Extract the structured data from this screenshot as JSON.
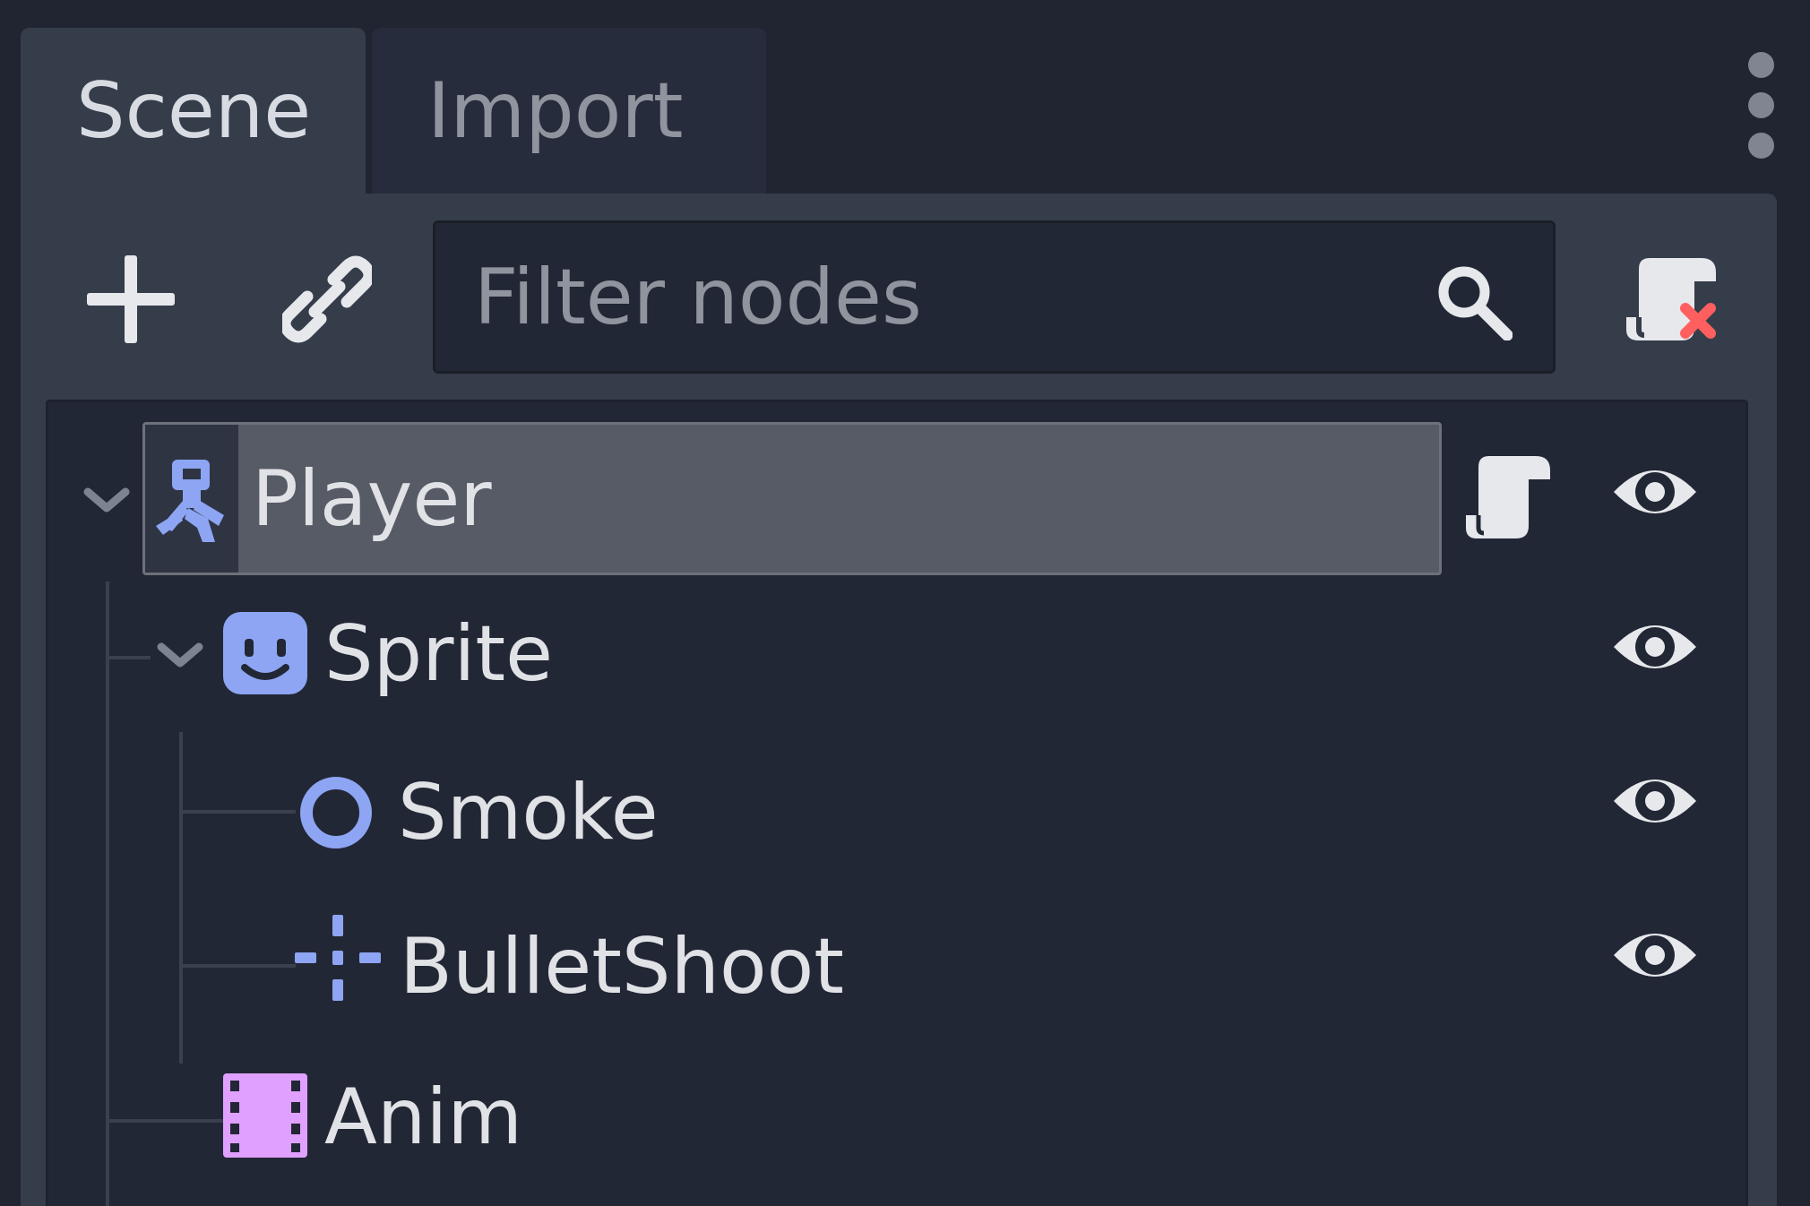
{
  "tabs": [
    {
      "label": "Scene",
      "active": true
    },
    {
      "label": "Import",
      "active": false
    }
  ],
  "toolbar": {
    "add_icon": "plus-icon",
    "link_icon": "link-icon",
    "filter_placeholder": "Filter nodes",
    "filter_value": "",
    "search_icon": "search-icon",
    "script_icon": "script-remove-icon"
  },
  "tree": {
    "nodes": [
      {
        "label": "Player",
        "depth": 0,
        "icon": "kinematic-body-icon",
        "expanded": true,
        "selected": true,
        "has_script": true,
        "visible": true
      },
      {
        "label": "Sprite",
        "depth": 1,
        "icon": "sprite-icon",
        "expanded": true,
        "selected": false,
        "has_script": false,
        "visible": true
      },
      {
        "label": "Smoke",
        "depth": 2,
        "icon": "particles-icon",
        "expanded": false,
        "selected": false,
        "has_script": false,
        "visible": true
      },
      {
        "label": "BulletShoot",
        "depth": 2,
        "icon": "position-icon",
        "expanded": false,
        "selected": false,
        "has_script": false,
        "visible": true
      },
      {
        "label": "Anim",
        "depth": 1,
        "icon": "animation-player-icon",
        "expanded": false,
        "selected": false,
        "has_script": false,
        "visible": true
      }
    ]
  },
  "colors": {
    "background": "#202531",
    "panel": "#363d4a",
    "tree_bg": "#222735",
    "selection": "#575b66",
    "text": "#e0e2e6",
    "muted_text": "#8f949e",
    "node_blue": "#8da5f3",
    "anim_purple": "#e0a0ff",
    "remove_red": "#ff5f5f"
  }
}
